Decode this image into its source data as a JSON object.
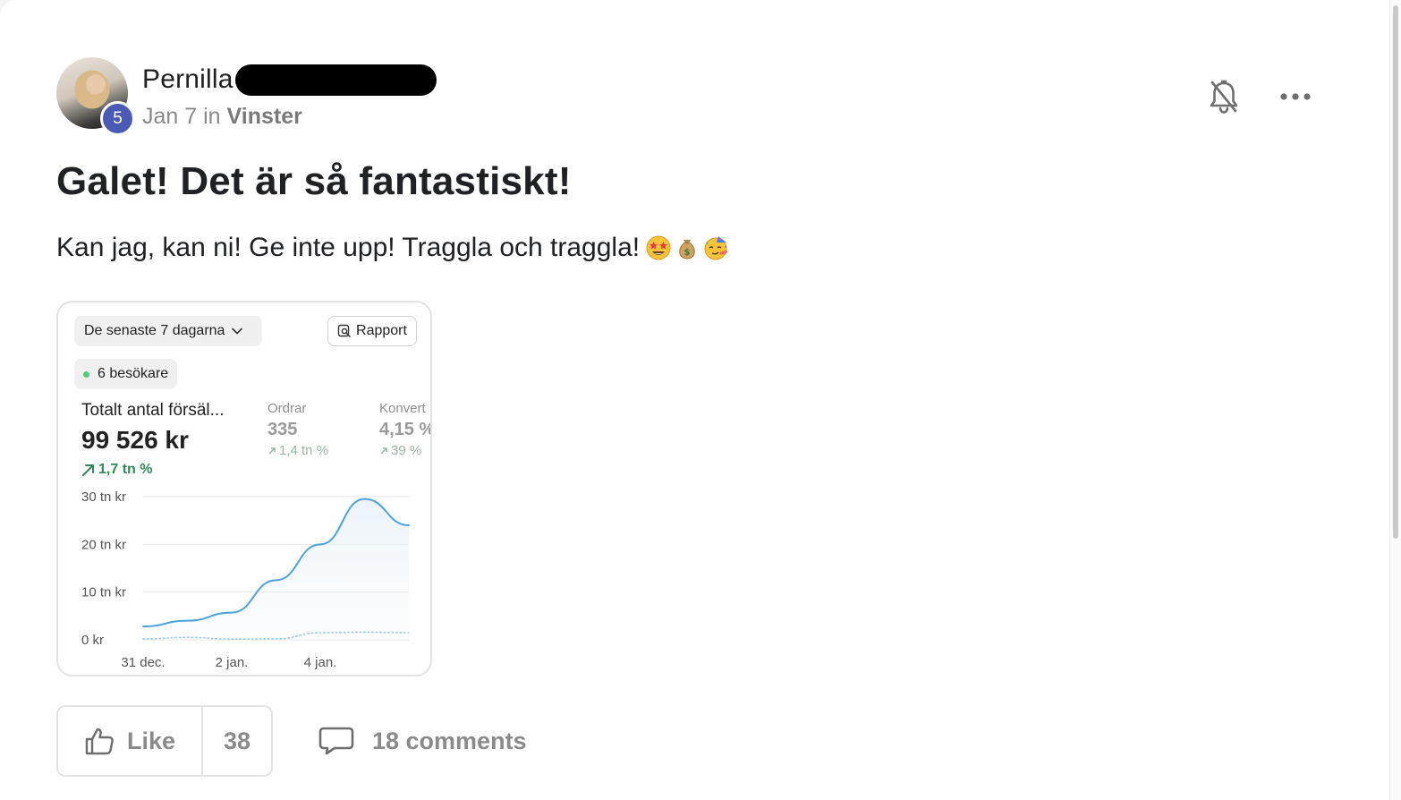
{
  "post": {
    "author_name": "Pernilla",
    "level": "5",
    "date": "Jan 7",
    "in_word": "in",
    "category": "Vinster",
    "title": "Galet! Det är så fantastiskt!",
    "body": "Kan jag, kan ni! Ge inte upp! Traggla och traggla!",
    "emojis": [
      "star-struck-emoji",
      "money-bag-emoji",
      "partying-face-emoji"
    ]
  },
  "header_actions": {
    "bell_icon": "bell-off-icon",
    "more_icon": "more-horizontal-icon"
  },
  "embed": {
    "date_range": "De senaste 7 dagarna",
    "report_label": "Rapport",
    "visitors_label": "6 besökare",
    "visitors_dot_color": "#4ed07a",
    "main_metric": {
      "label": "Totalt antal försäl...",
      "value": "99 526 kr",
      "change": "1,7 tn %",
      "change_color": "#2e8b57"
    },
    "metric_orders": {
      "label": "Ordrar",
      "value": "335",
      "change": "1,4 tn %"
    },
    "metric_conversion": {
      "label": "Konvert",
      "value": "4,15 %",
      "change": "39 %"
    }
  },
  "chart_data": {
    "type": "line",
    "x_tick_labels": [
      "31 dec.",
      "2 jan.",
      "4 jan."
    ],
    "y_tick_labels": [
      "30 tn kr",
      "20 tn kr",
      "10 tn kr",
      "0 kr"
    ],
    "ylim": [
      0,
      30000
    ],
    "x": [
      "31 dec.",
      "1 jan.",
      "2 jan.",
      "3 jan.",
      "4 jan.",
      "5 jan.",
      "6 jan."
    ],
    "series": [
      {
        "values": [
          2800,
          4000,
          5700,
          12500,
          20000,
          29500,
          24000
        ],
        "color": "#4aa3df",
        "style": "solid"
      },
      {
        "values": [
          200,
          500,
          150,
          200,
          1500,
          1600,
          1500
        ],
        "color": "#9ccbe9",
        "style": "dotted"
      }
    ],
    "grid": true
  },
  "actions": {
    "like_label": "Like",
    "like_count": "38",
    "comments_label": "18 comments"
  },
  "colors": {
    "level_badge": "#4b5bb5",
    "muted_text": "#8a8a8a",
    "chart_line": "#4aa3df"
  }
}
